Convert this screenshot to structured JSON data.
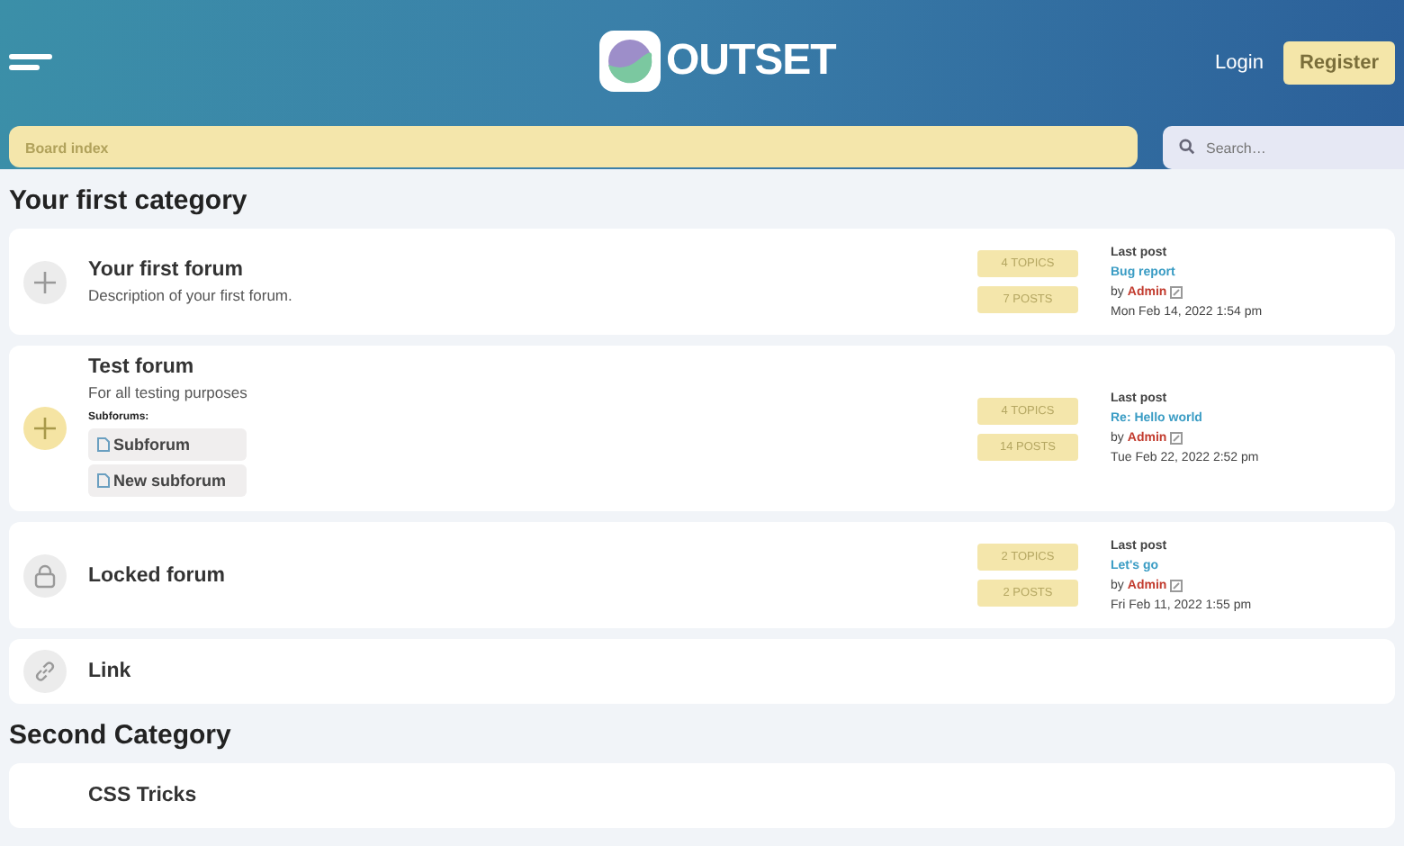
{
  "header": {
    "logo_text": "OUTSET",
    "login": "Login",
    "register": "Register"
  },
  "breadcrumb": "Board index",
  "search": {
    "placeholder": "Search…"
  },
  "categories": [
    {
      "title": "Your first category",
      "forums": [
        {
          "kind": "read",
          "name": "Your first forum",
          "description": "Description of your first forum.",
          "topics": "4 TOPICS",
          "posts": "7 POSTS",
          "last_post": {
            "label": "Last post",
            "title": "Bug report",
            "by": "by",
            "author": "Admin",
            "date": "Mon Feb 14, 2022 1:54 pm"
          }
        },
        {
          "kind": "unread",
          "name": "Test forum",
          "description": "For all testing purposes",
          "subforums_label": "Subforums:",
          "subforums": [
            "Subforum",
            "New subforum"
          ],
          "topics": "4 TOPICS",
          "posts": "14 POSTS",
          "last_post": {
            "label": "Last post",
            "title": "Re: Hello world",
            "by": "by",
            "author": "Admin",
            "date": "Tue Feb 22, 2022 2:52 pm"
          }
        },
        {
          "kind": "locked",
          "name": "Locked forum",
          "topics": "2 TOPICS",
          "posts": "2 POSTS",
          "last_post": {
            "label": "Last post",
            "title": "Let's go",
            "by": "by",
            "author": "Admin",
            "date": "Fri Feb 11, 2022 1:55 pm"
          }
        },
        {
          "kind": "link",
          "name": "Link"
        }
      ]
    },
    {
      "title": "Second Category",
      "forums": [
        {
          "kind": "plain",
          "name": "CSS Tricks"
        }
      ]
    }
  ]
}
